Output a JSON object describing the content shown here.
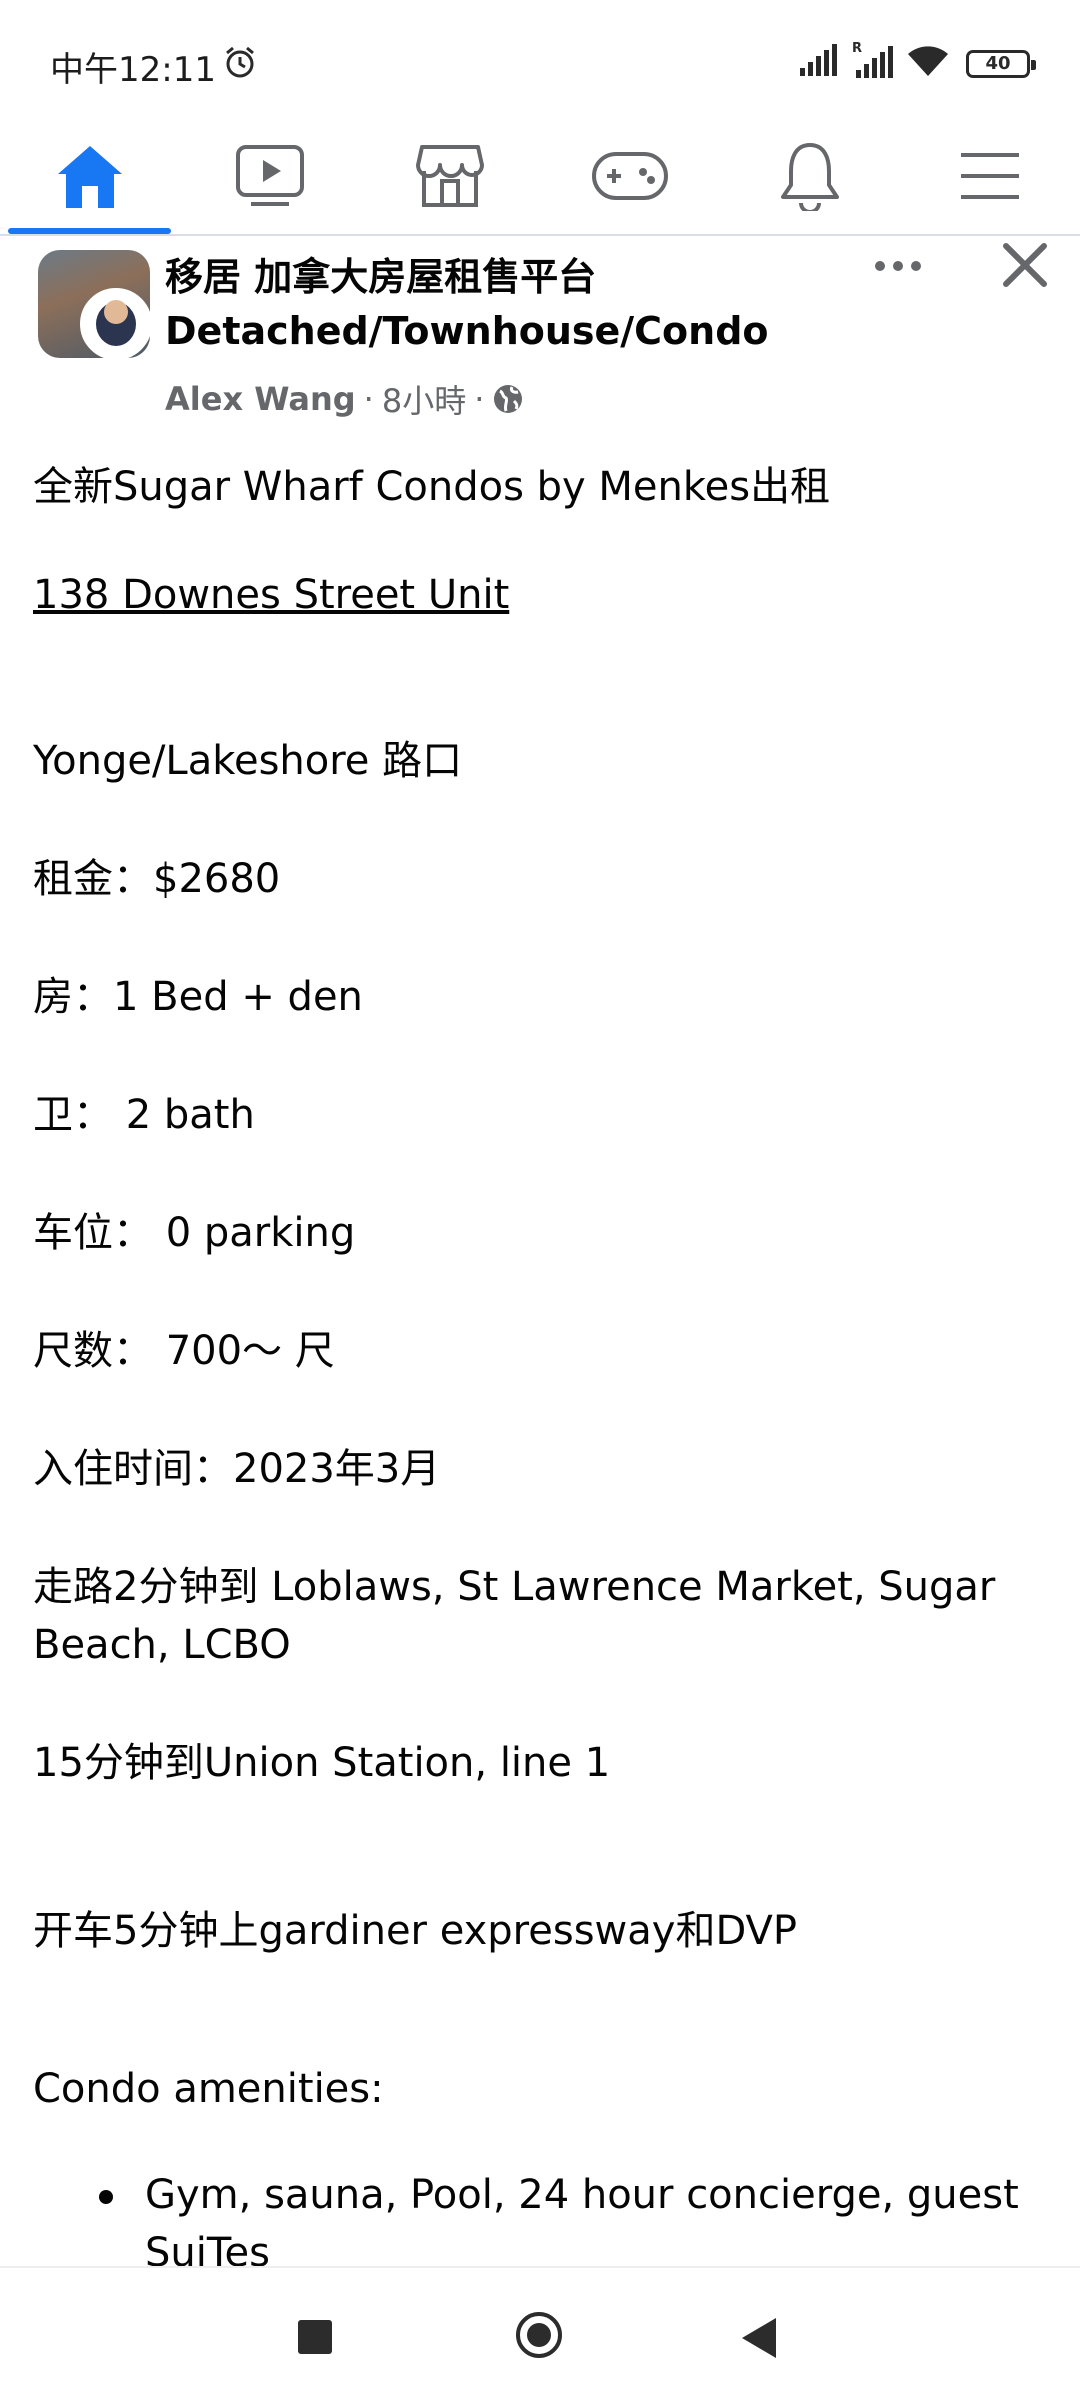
{
  "status_bar": {
    "time": "中午12:11",
    "battery": "40"
  },
  "nav": {
    "tabs": [
      "home-icon",
      "watch-icon",
      "marketplace-icon",
      "gaming-icon",
      "notifications-icon",
      "menu-icon"
    ],
    "accent_color": "#1877f2"
  },
  "post": {
    "group_title": "移居 加拿大房屋租售平台 Detached/Townhouse/Condo",
    "author": "Alex Wang",
    "time_ago": "8小時",
    "separator": "·",
    "lines": {
      "l1": "全新Sugar Wharf Condos by Menkes出租",
      "l2": "138 Downes Street Unit",
      "l3": "Yonge/Lakeshore 路口",
      "l4": "租金：$2680",
      "l5": "房：1 Bed + den",
      "l6": "卫： 2 bath",
      "l7": "车位： 0 parking",
      "l8": "尺数： 700～ 尺",
      "l9": "入住时间：2023年3月",
      "l10": "走路2分钟到 Loblaws, St Lawrence Market, Sugar Beach, LCBO",
      "l11": "15分钟到Union Station, line 1",
      "l12": "开车5分钟上gardiner expressway和DVP",
      "l13": "Condo amenities:"
    },
    "bullets": [
      "Gym, sauna, Pool, 24 hour concierge, guest SuiTes"
    ]
  }
}
